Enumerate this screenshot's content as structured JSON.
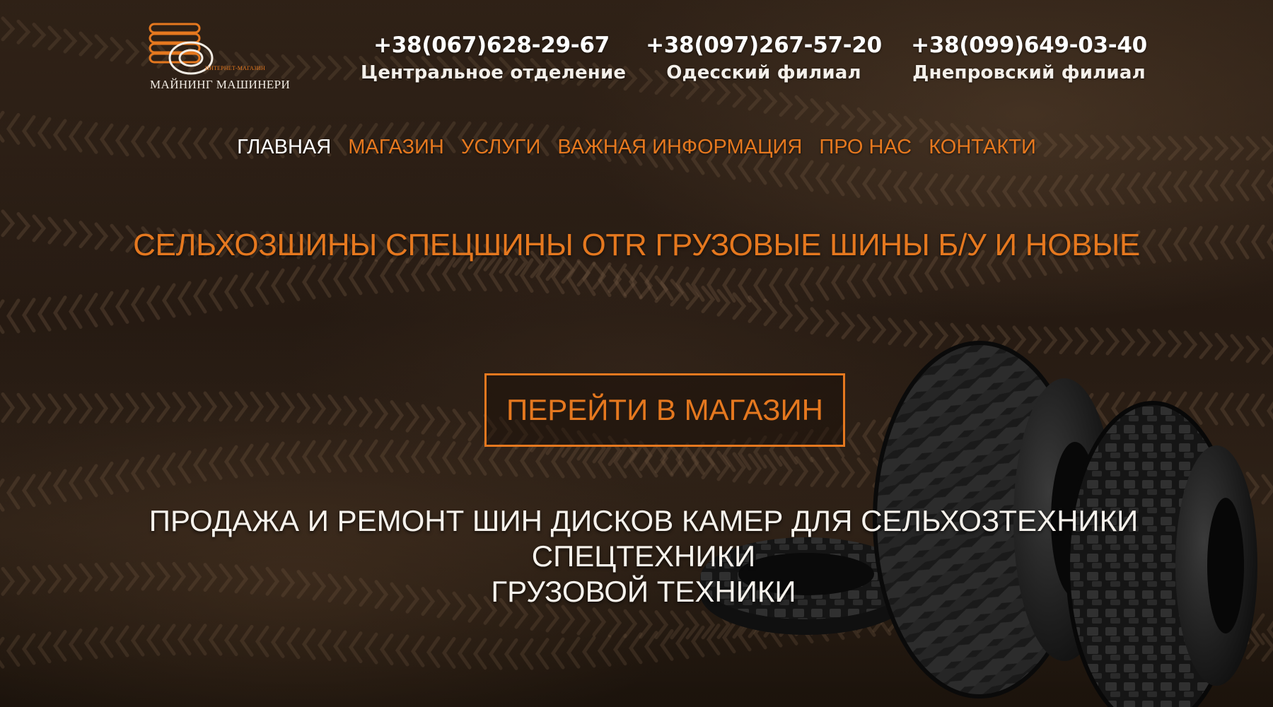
{
  "brand": {
    "name": "МАЙНИНГ МАШИНЕРИ",
    "tagline": "ИНТЕРНЕТ-МАГАЗИН",
    "logo_icon": "tire-stack-logo",
    "accent_color": "#e5781f"
  },
  "contacts": [
    {
      "phone": "+38(067)628-29-67",
      "branch": "Центральное  отделение"
    },
    {
      "phone": "+38(097)267-57-20",
      "branch": "Одесский филиал"
    },
    {
      "phone": "+38(099)649-03-40",
      "branch": "Днепровский  филиал"
    }
  ],
  "nav": {
    "items": [
      {
        "label": "ГЛАВНАЯ",
        "active": true
      },
      {
        "label": "МАГАЗИН",
        "active": false
      },
      {
        "label": "УСЛУГИ",
        "active": false
      },
      {
        "label": "ВАЖНАЯ ИНФОРМАЦИЯ",
        "active": false
      },
      {
        "label": "ПРО НАС",
        "active": false
      },
      {
        "label": "КОНТАКТИ",
        "active": false
      }
    ]
  },
  "hero": {
    "headline": "СЕЛЬХОЗШИНЫ СПЕЦШИНЫ OTR ГРУЗОВЫЕ ШИНЫ Б/У И НОВЫЕ",
    "cta_label": "ПЕРЕЙТИ В МАГАЗИН",
    "subheadline_line1": "ПРОДАЖА И РЕМОНТ ШИН ДИСКОВ КАМЕР ДЛЯ СЕЛЬХОЗТЕХНИКИ СПЕЦТЕХНИКИ",
    "subheadline_line2": "ГРУЗОВОЙ ТЕХНИКИ",
    "background": "tire-tracks-in-mud-photo",
    "illustration": "tires-image"
  }
}
